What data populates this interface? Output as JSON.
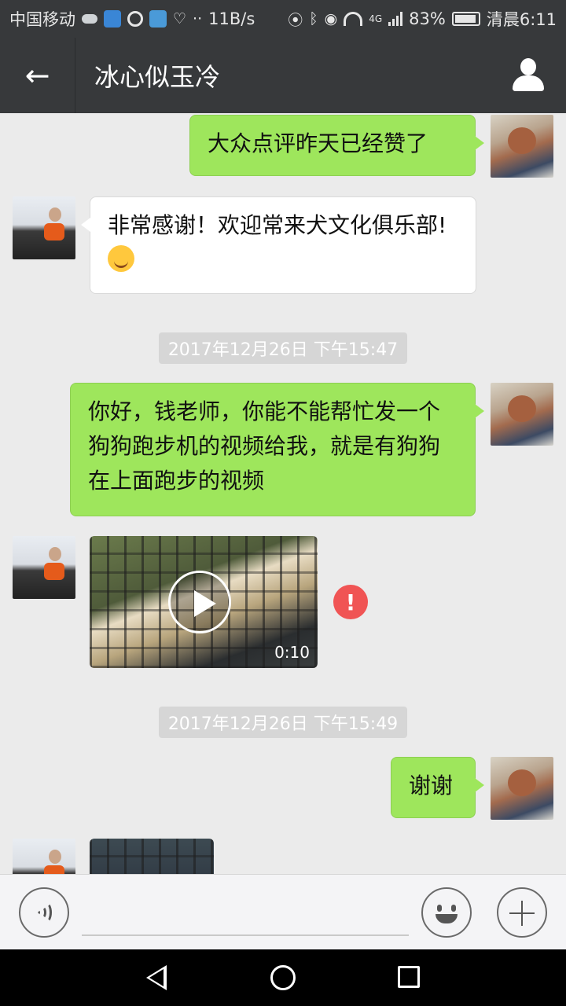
{
  "status_bar": {
    "carrier": "中国移动",
    "net_speed": "11B/s",
    "network_type": "4G",
    "battery": "83%",
    "time": "清晨6:11"
  },
  "header": {
    "title": "冰心似玉冷",
    "back_icon": "back-arrow-icon",
    "profile_icon": "person-icon"
  },
  "messages": [
    {
      "side": "sent",
      "text": "大众点评昨天已经赞了"
    },
    {
      "side": "recv",
      "text": "非常感谢！欢迎常来犬文化俱乐部!"
    },
    {
      "timestamp": "2017年12月26日 下午15:47"
    },
    {
      "side": "sent",
      "text": "你好，钱老师，你能不能帮忙发一个狗狗跑步机的视频给我，就是有狗狗在上面跑步的视频"
    },
    {
      "side": "recv",
      "type": "video",
      "duration": "0:10",
      "status": "!"
    },
    {
      "timestamp": "2017年12月26日 下午15:49"
    },
    {
      "side": "sent",
      "text": "谢谢"
    },
    {
      "side": "recv",
      "type": "image"
    }
  ],
  "input_bar": {
    "voice_icon": "voice-icon",
    "emoji_icon": "emoji-icon",
    "plus_icon": "plus-icon",
    "text": ""
  },
  "colors": {
    "header_bg": "#37393b",
    "sent_bubble": "#9ee65c",
    "recv_bubble": "#ffffff",
    "error": "#f05454",
    "chat_bg": "#ebebeb"
  }
}
